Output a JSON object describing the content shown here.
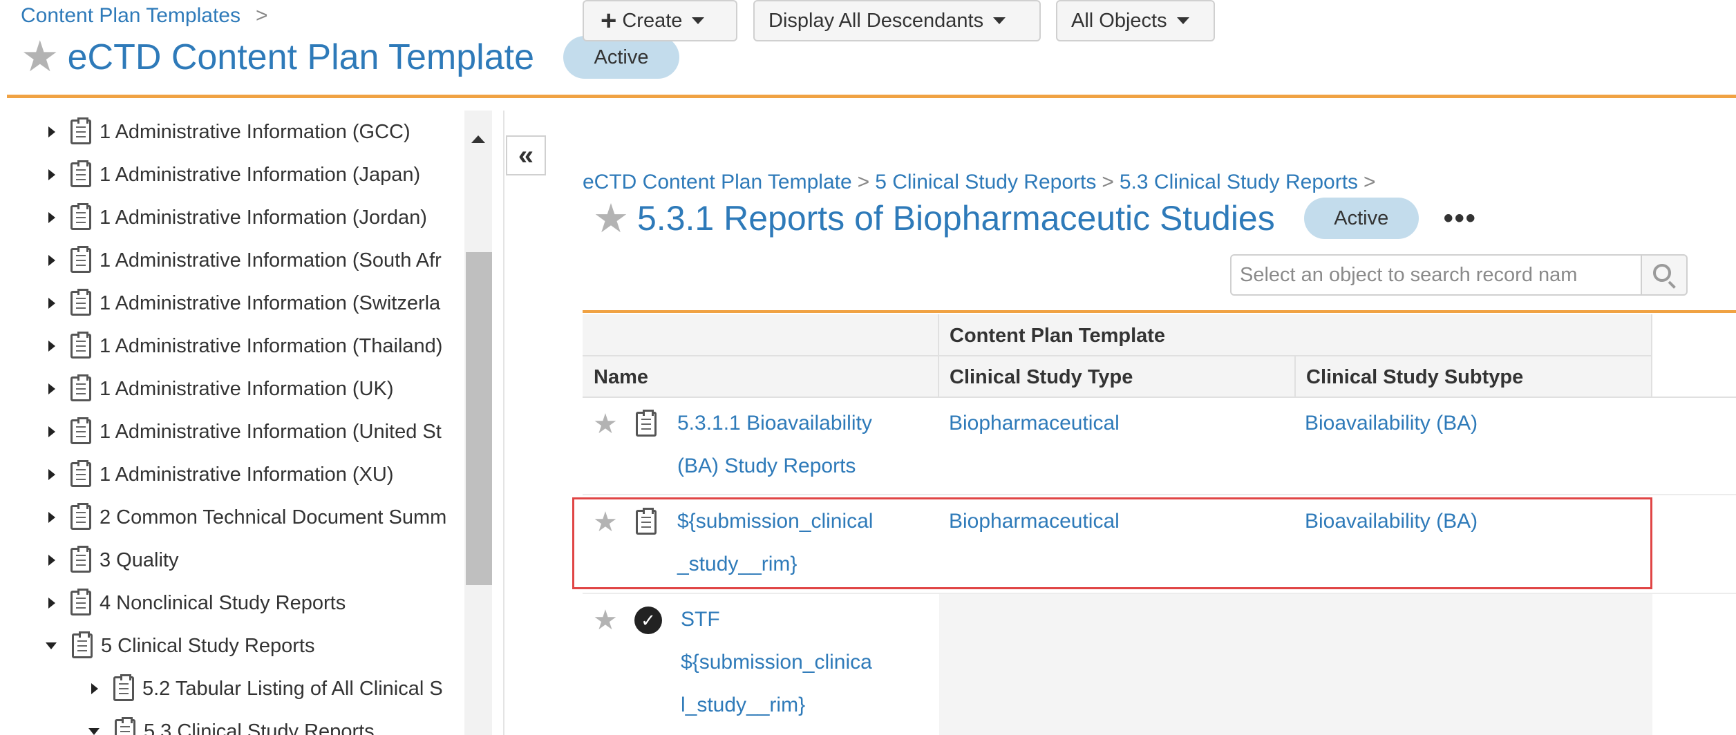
{
  "header": {
    "breadcrumb": "Content Plan Templates",
    "breadcrumb_sep": ">",
    "title": "eCTD Content Plan Template",
    "status": "Active"
  },
  "tree": {
    "items": [
      {
        "label": "1 Administrative Information (GCC)",
        "expanded": false
      },
      {
        "label": "1 Administrative Information (Japan)",
        "expanded": false
      },
      {
        "label": "1 Administrative Information (Jordan)",
        "expanded": false
      },
      {
        "label": "1 Administrative Information (South Afr",
        "expanded": false
      },
      {
        "label": "1 Administrative Information (Switzerla",
        "expanded": false
      },
      {
        "label": "1 Administrative Information (Thailand)",
        "expanded": false
      },
      {
        "label": "1 Administrative Information (UK)",
        "expanded": false
      },
      {
        "label": "1 Administrative Information (United St",
        "expanded": false
      },
      {
        "label": "1 Administrative Information (XU)",
        "expanded": false
      },
      {
        "label": "2 Common Technical Document Summ",
        "expanded": false
      },
      {
        "label": "3 Quality",
        "expanded": false
      },
      {
        "label": "4 Nonclinical Study Reports",
        "expanded": false
      },
      {
        "label": "5 Clinical Study Reports",
        "expanded": true
      },
      {
        "label": "5.2 Tabular Listing of All Clinical S",
        "expanded": false
      },
      {
        "label": "5.3 Clinical Study Reports",
        "expanded": true
      }
    ],
    "collapse_label": "«"
  },
  "detail": {
    "breadcrumb": [
      "eCTD Content Plan Template",
      "5 Clinical Study Reports",
      "5.3 Clinical Study Reports"
    ],
    "breadcrumb_sep": ">",
    "title": "5.3.1 Reports of Biopharmaceutic Studies",
    "status": "Active",
    "more_label": "•••"
  },
  "toolbar": {
    "create_label": "Create",
    "display_label": "Display All Descendants",
    "objects_label": "All Objects",
    "search_placeholder": "Select an object to search record nam"
  },
  "table": {
    "group_header": "Content Plan Template",
    "columns": [
      "Name",
      "Clinical Study Type",
      "Clinical Study Subtype"
    ],
    "rows": [
      {
        "name": [
          "5.3.1.1 Bioavailability",
          "(BA) Study Reports"
        ],
        "type": "Biopharmaceutical",
        "subtype": "Bioavailability (BA)",
        "icon": "doc-list-icon",
        "selected": false
      },
      {
        "name": [
          "${submission_clinical",
          "_study__rim}"
        ],
        "type": "Biopharmaceutical",
        "subtype": "Bioavailability (BA)",
        "icon": "doc-list-icon",
        "selected": true
      },
      {
        "name": [
          "STF",
          "${submission_clinica",
          "l_study__rim}"
        ],
        "type": "",
        "subtype": "",
        "icon": "check-circle-icon",
        "selected": false
      }
    ]
  },
  "colors": {
    "link": "#2e7ab9",
    "accent_rule": "#f0a243",
    "badge_bg": "#c3dcec",
    "selection_border": "#e04545"
  }
}
